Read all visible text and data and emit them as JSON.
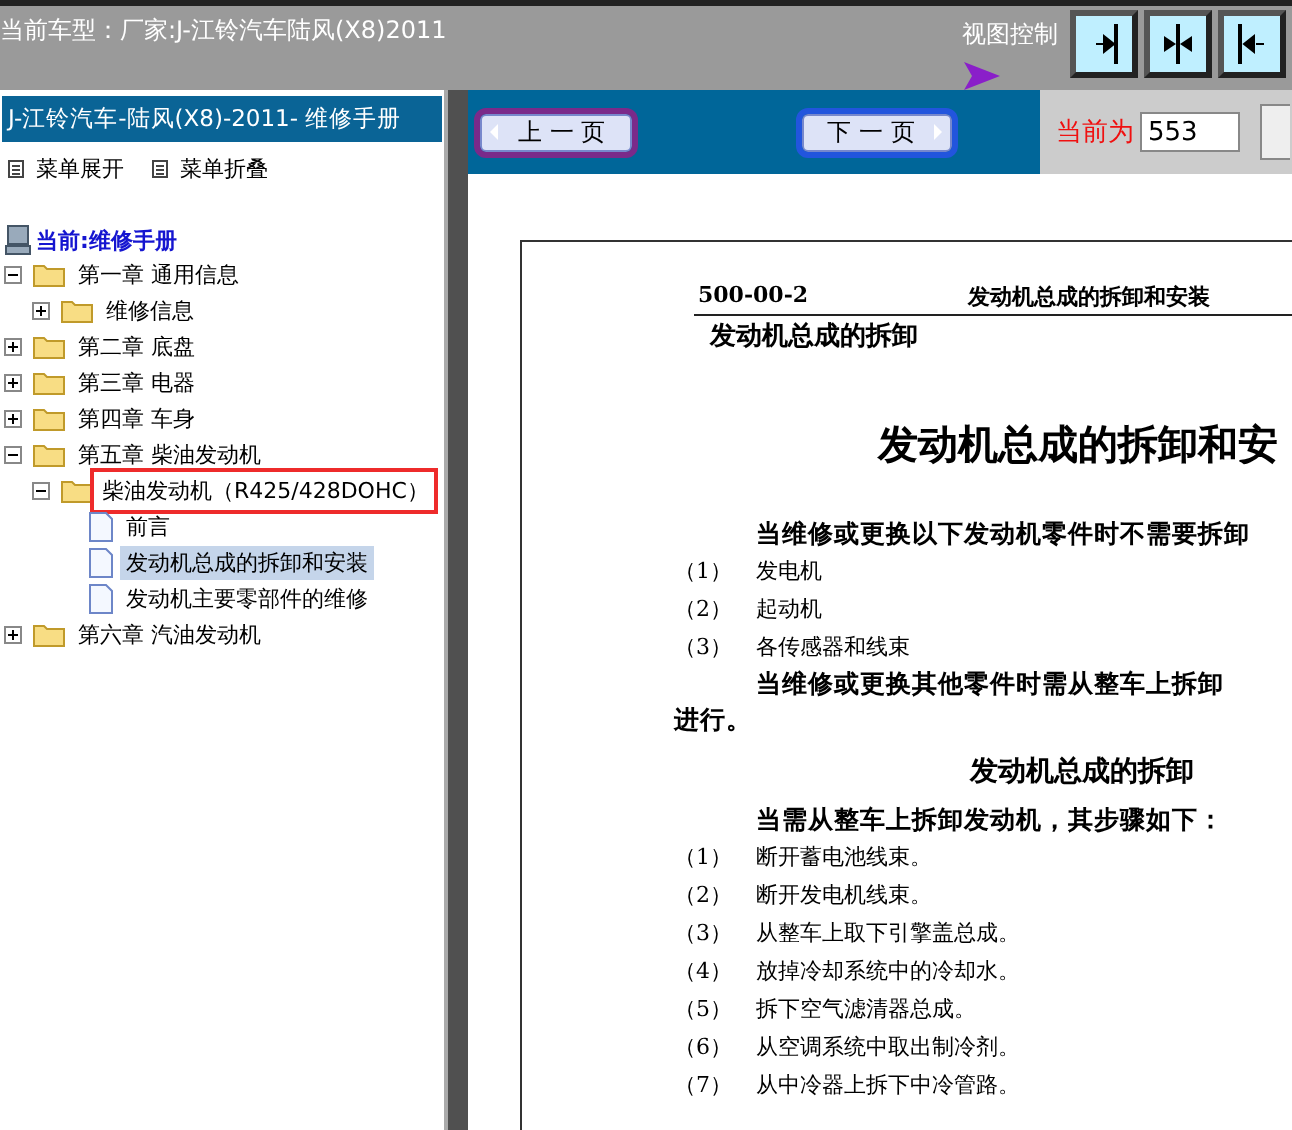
{
  "top_bar": {
    "title": "当前车型：厂家:J-江铃汽车陆风(X8)2011",
    "view_control_label": "视图控制",
    "view_buttons": [
      {
        "kind": "right"
      },
      {
        "kind": "split"
      },
      {
        "kind": "left"
      }
    ]
  },
  "sidebar": {
    "title": "J-江铃汽车-陆风(X8)-2011- 维修手册",
    "menu_actions": [
      "菜单展开",
      "菜单折叠"
    ],
    "current": "当前:维修手册",
    "tree": [
      {
        "label": "第一章 通用信息",
        "kind": "folder",
        "expanded": true,
        "selected": false,
        "marked": false,
        "children": [
          {
            "label": "维修信息",
            "kind": "folder",
            "expanded": false,
            "selected": false,
            "marked": false
          }
        ]
      },
      {
        "label": "第二章 底盘",
        "kind": "folder",
        "expanded": false,
        "selected": false,
        "marked": false
      },
      {
        "label": "第三章 电器",
        "kind": "folder",
        "expanded": false,
        "selected": false,
        "marked": false
      },
      {
        "label": "第四章 车身",
        "kind": "folder",
        "expanded": false,
        "selected": false,
        "marked": false
      },
      {
        "label": "第五章 柴油发动机",
        "kind": "folder",
        "expanded": true,
        "selected": false,
        "marked": false,
        "children": [
          {
            "label": "柴油发动机（R425/428DOHC）",
            "kind": "folder",
            "expanded": true,
            "selected": false,
            "marked": true,
            "children": [
              {
                "label": "前言",
                "kind": "page",
                "selected": false,
                "marked": false
              },
              {
                "label": "发动机总成的拆卸和安装",
                "kind": "page",
                "selected": true,
                "marked": false
              },
              {
                "label": "发动机主要零部件的维修",
                "kind": "page",
                "selected": false,
                "marked": false
              }
            ]
          }
        ]
      },
      {
        "label": "第六章 汽油发动机",
        "kind": "folder",
        "expanded": false,
        "selected": false,
        "marked": false
      }
    ]
  },
  "toolbar": {
    "prev_button": "上 一 页",
    "next_button": "下 一 页",
    "current_label": "当前为",
    "page_field": {
      "value": "553"
    }
  },
  "document": {
    "header_code": "500-00-2",
    "header_title": "发动机总成的拆卸和安装",
    "blocks": [
      {
        "kind": "subtitle",
        "text": "发动机总成的拆卸"
      },
      {
        "kind": "title",
        "text": "发动机总成的拆卸和安"
      },
      {
        "kind": "lead",
        "text": "当维修或更换以下发动机零件时不需要拆卸"
      },
      {
        "kind": "item",
        "number": "（1）",
        "text": "发电机"
      },
      {
        "kind": "item",
        "number": "（2）",
        "text": "起动机"
      },
      {
        "kind": "item",
        "number": "（3）",
        "text": "各传感器和线束"
      },
      {
        "kind": "lead",
        "text": "当维修或更换其他零件时需从整车上拆卸"
      },
      {
        "kind": "cont",
        "text": "进行。"
      },
      {
        "kind": "heading",
        "text": "发动机总成的拆卸"
      },
      {
        "kind": "lead",
        "text": "当需从整车上拆卸发动机，其步骤如下："
      },
      {
        "kind": "item",
        "number": "（1）",
        "text": "断开蓄电池线束。"
      },
      {
        "kind": "item",
        "number": "（2）",
        "text": "断开发电机线束。"
      },
      {
        "kind": "item",
        "number": "（3）",
        "text": "从整车上取下引擎盖总成。"
      },
      {
        "kind": "item",
        "number": "（4）",
        "text": "放掉冷却系统中的冷却水。"
      },
      {
        "kind": "item",
        "number": "（5）",
        "text": "拆下空气滤清器总成。"
      },
      {
        "kind": "item",
        "number": "（6）",
        "text": "从空调系统中取出制冷剂。"
      },
      {
        "kind": "item",
        "number": "（7）",
        "text": "从中冷器上拆下中冷管路。"
      }
    ]
  }
}
